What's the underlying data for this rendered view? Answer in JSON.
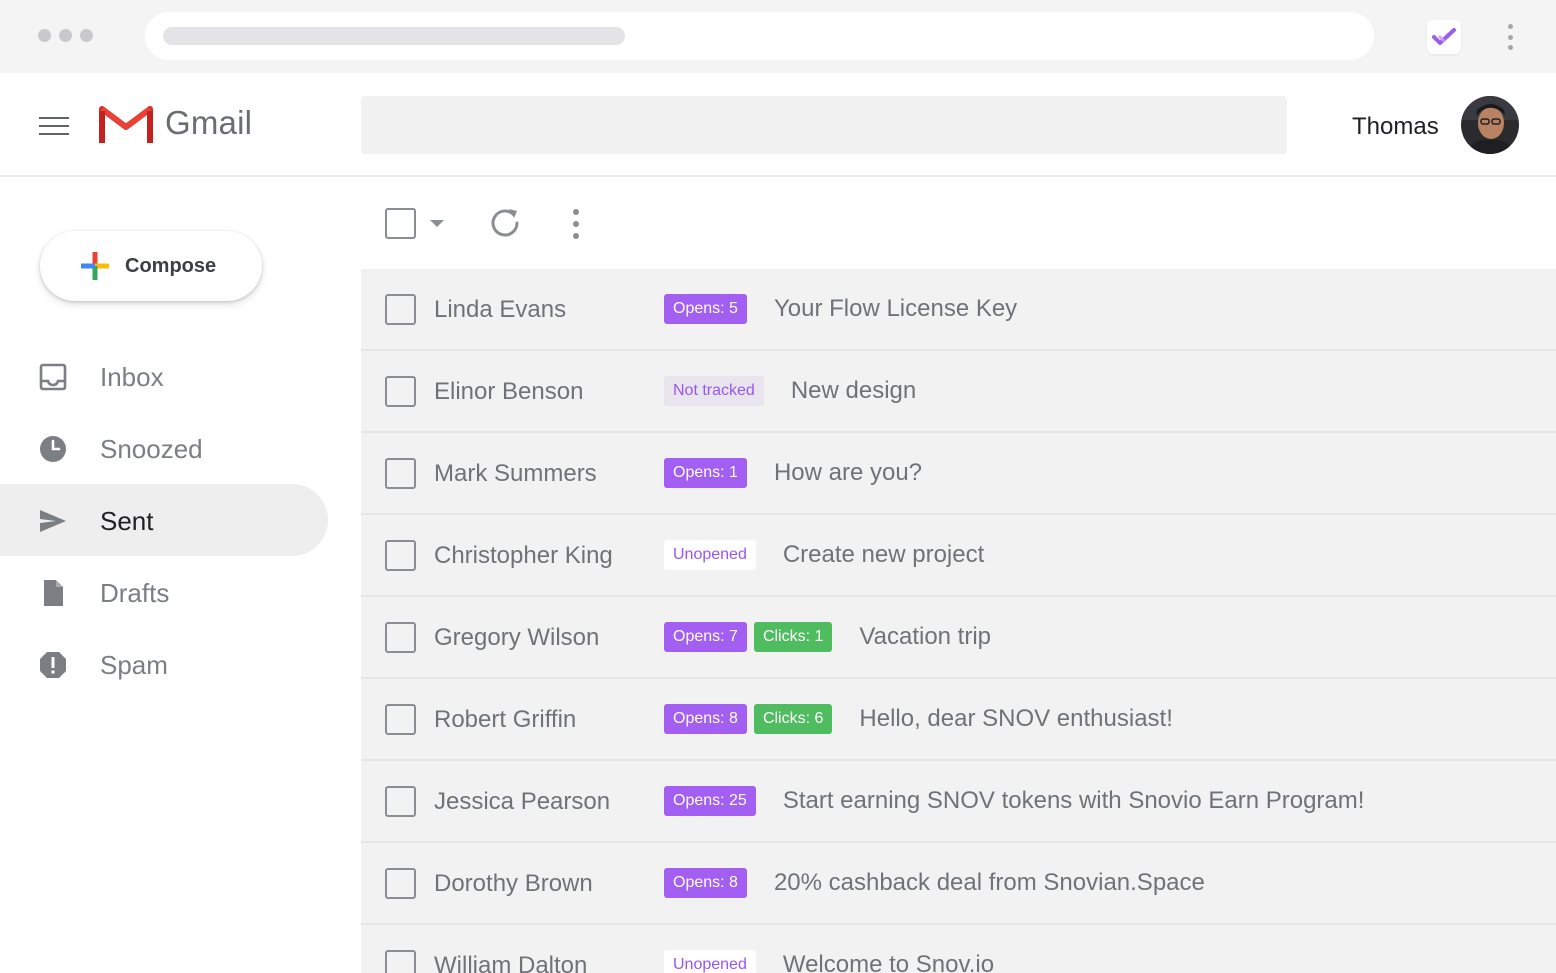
{
  "browser": {
    "window_dots": [
      "dot",
      "dot",
      "dot"
    ],
    "extension_icon": "check-icon",
    "extension_color": "#9b5df0"
  },
  "header": {
    "brand": "Gmail",
    "user_name": "Thomas",
    "search_placeholder": ""
  },
  "sidebar": {
    "compose_label": "Compose",
    "items": [
      {
        "label": "Inbox",
        "icon": "inbox-icon",
        "active": false
      },
      {
        "label": "Snoozed",
        "icon": "clock-icon",
        "active": false
      },
      {
        "label": "Sent",
        "icon": "send-icon",
        "active": true
      },
      {
        "label": "Drafts",
        "icon": "draft-icon",
        "active": false
      },
      {
        "label": "Spam",
        "icon": "spam-icon",
        "active": false
      }
    ]
  },
  "colors": {
    "opens_badge": "#a35ef2",
    "clicks_badge": "#4fbd5f",
    "status_text": "#9a57f0"
  },
  "emails": [
    {
      "sender": "Linda Evans",
      "tags": [
        {
          "type": "opens",
          "label": "Opens: 5"
        }
      ],
      "subject": "Your Flow License Key"
    },
    {
      "sender": "Elinor Benson",
      "tags": [
        {
          "type": "not-tracked",
          "label": "Not tracked"
        }
      ],
      "subject": "New design"
    },
    {
      "sender": "Mark Summers",
      "tags": [
        {
          "type": "opens",
          "label": "Opens: 1"
        }
      ],
      "subject": "How are you?"
    },
    {
      "sender": "Christopher King",
      "tags": [
        {
          "type": "unopened",
          "label": "Unopened"
        }
      ],
      "subject": "Create new project"
    },
    {
      "sender": "Gregory Wilson",
      "tags": [
        {
          "type": "opens",
          "label": "Opens: 7"
        },
        {
          "type": "clicks",
          "label": "Clicks: 1"
        }
      ],
      "subject": "Vacation trip"
    },
    {
      "sender": "Robert Griffin",
      "tags": [
        {
          "type": "opens",
          "label": "Opens: 8"
        },
        {
          "type": "clicks",
          "label": "Clicks: 6"
        }
      ],
      "subject": "Hello, dear SNOV enthusiast!"
    },
    {
      "sender": "Jessica Pearson",
      "tags": [
        {
          "type": "opens",
          "label": "Opens: 25"
        }
      ],
      "subject": "Start earning SNOV tokens with Snovio Earn Program!"
    },
    {
      "sender": "Dorothy Brown",
      "tags": [
        {
          "type": "opens",
          "label": "Opens: 8"
        }
      ],
      "subject": "20% cashback deal from Snovian.Space"
    },
    {
      "sender": "William Dalton",
      "tags": [
        {
          "type": "unopened",
          "label": "Unopened"
        }
      ],
      "subject": "Welcome to Snov.io"
    }
  ]
}
